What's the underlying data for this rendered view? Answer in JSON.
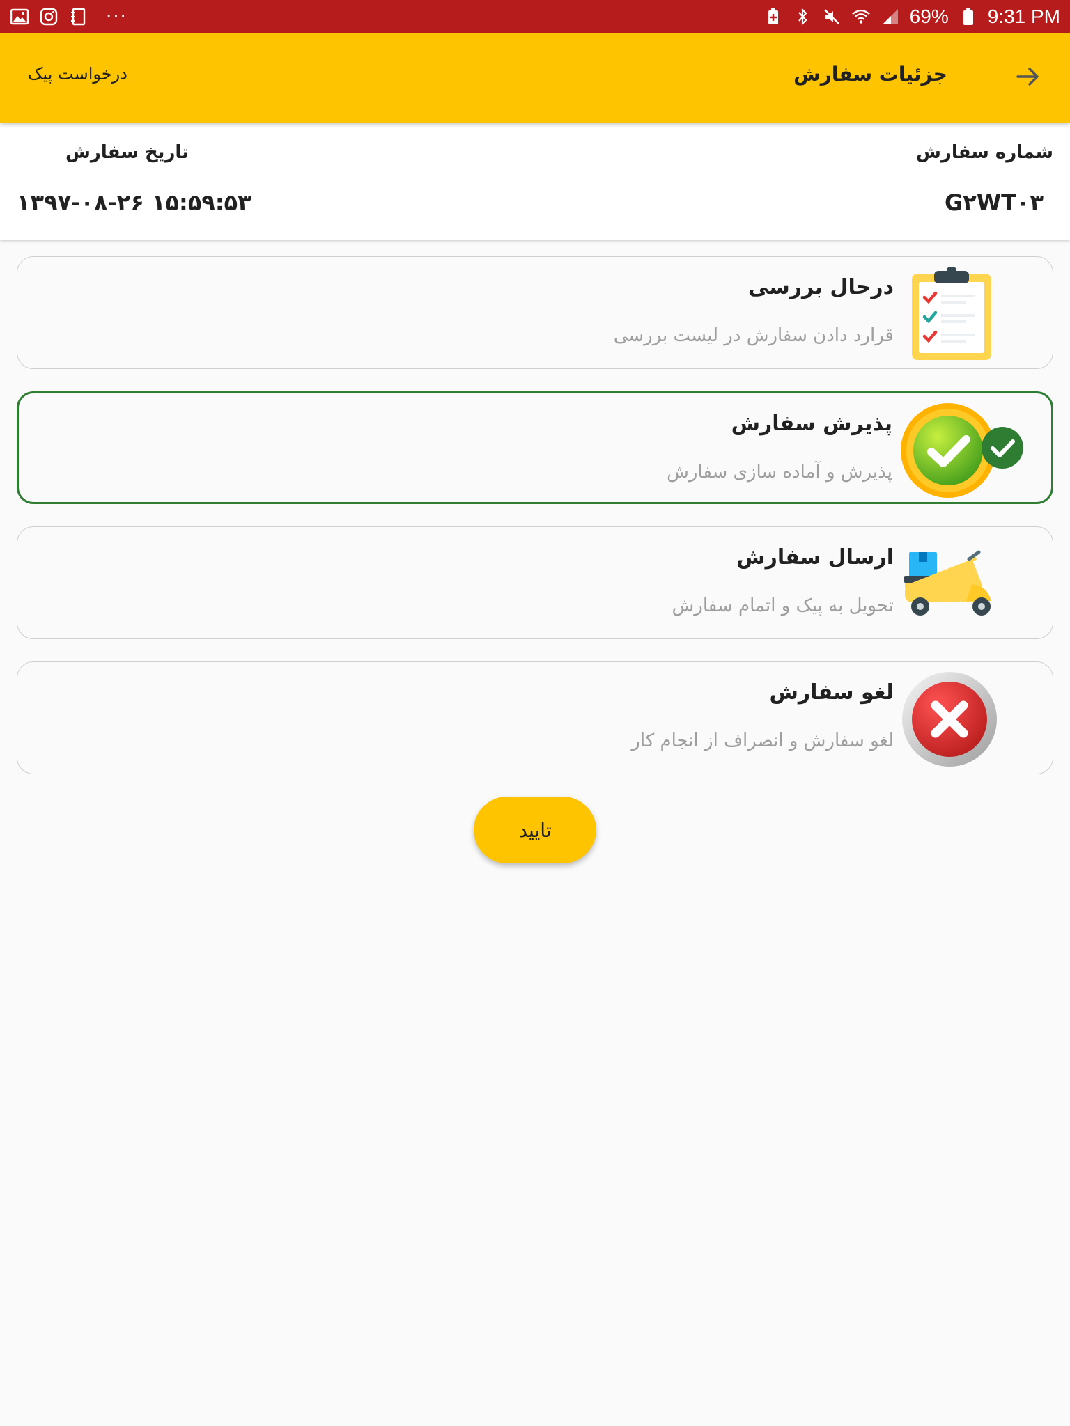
{
  "status_bar": {
    "battery": "69%",
    "time": "9:31 PM",
    "icons": [
      "gallery-icon",
      "instagram-icon",
      "notebook-icon",
      "more-dots-icon",
      "battery-saver-icon",
      "bluetooth-icon",
      "mute-icon",
      "wifi-icon",
      "signal-icon",
      "battery-icon"
    ]
  },
  "app_bar": {
    "title": "جزئیات سفارش",
    "action": "درخواست پیک",
    "back_icon": "arrow-right-icon"
  },
  "order_info": {
    "number_label": "شماره سفارش",
    "number_value": "G۲WT۰۳",
    "date_label": "تاریخ سفارش",
    "date_value": "۱۳۹۷-۰۸-۲۶ ۱۵:۵۹:۵۳"
  },
  "statuses": [
    {
      "title": "درحال بررسی",
      "description": "قرارد دادن سفارش در لیست بررسی",
      "icon": "clipboard-checklist-icon",
      "selected": false
    },
    {
      "title": "پذیرش سفارش",
      "description": "پذیرش و آماده سازی سفارش",
      "icon": "accept-check-icon",
      "selected": true
    },
    {
      "title": "ارسال سفارش",
      "description": "تحویل به پیک و اتمام سفارش",
      "icon": "delivery-scooter-icon",
      "selected": false
    },
    {
      "title": "لغو سفارش",
      "description": "لغو سفارش و انصراف از انجام کار",
      "icon": "cancel-x-icon",
      "selected": false
    }
  ],
  "confirm_label": "تایید",
  "colors": {
    "status_bar": "#b71c1c",
    "primary": "#ffc400",
    "selected_border": "#2e7d32",
    "card_border": "#cfcfcf",
    "subtitle_text": "#9e9e9e"
  }
}
